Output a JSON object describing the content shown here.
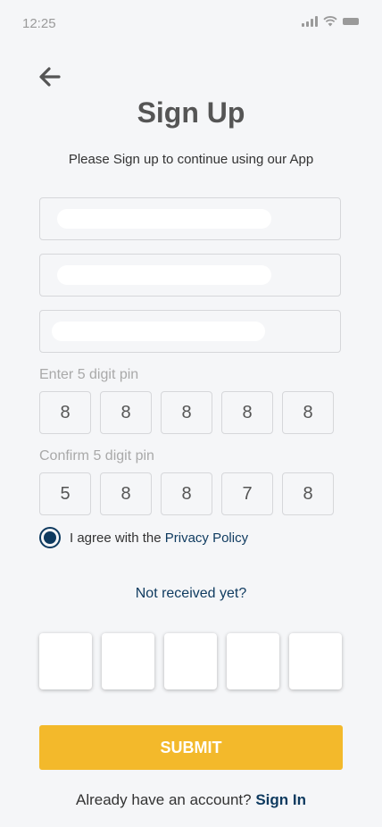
{
  "status_bar": {
    "time": "12:25"
  },
  "header": {
    "back_icon": "arrow-left-icon",
    "title": "Sign Up",
    "subtitle": "Please Sign up to continue using our App"
  },
  "pin": {
    "label": "Enter  5 digit pin",
    "digits": [
      "8",
      "8",
      "8",
      "8",
      "8"
    ]
  },
  "confirm_pin": {
    "label": "Confirm 5 digit pin",
    "digits": [
      "5",
      "8",
      "8",
      "7",
      "8"
    ]
  },
  "agreement": {
    "checked": true,
    "text": "I agree with the",
    "link": "Privacy Policy"
  },
  "otp": {
    "resend_label": "Not received yet?",
    "digits": [
      "",
      "",
      "",
      "",
      ""
    ]
  },
  "submit_label": "SUBMIT",
  "footer": {
    "text": "Already have an account?",
    "link": "Sign In"
  },
  "colors": {
    "accent": "#f3b92b",
    "link": "#0e3a5f",
    "background": "#f5f6f8"
  }
}
